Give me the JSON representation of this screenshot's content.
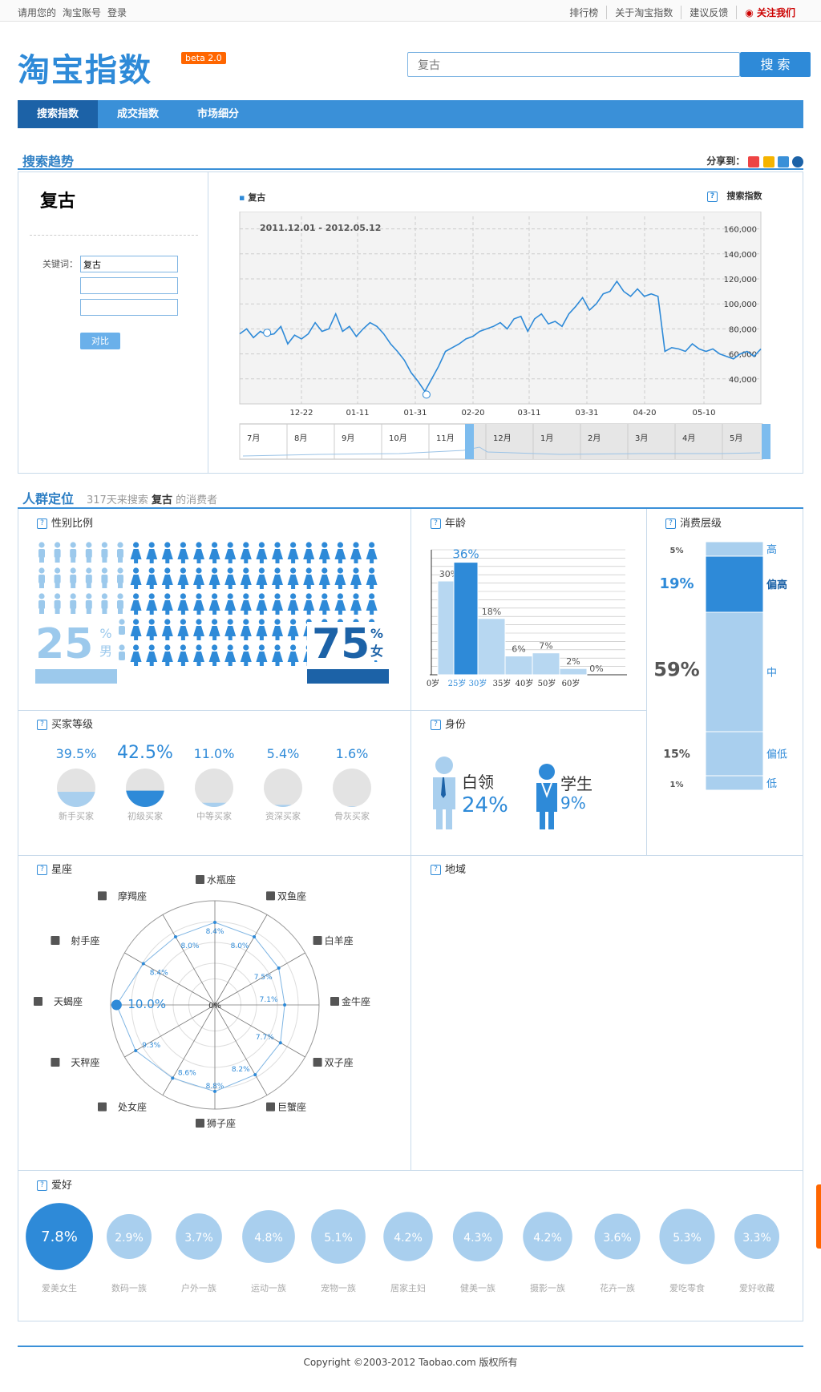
{
  "topbar": {
    "login_prompt": "请用您的",
    "account": "淘宝账号",
    "login": "登录",
    "links": [
      "排行榜",
      "关于淘宝指数",
      "建议反馈"
    ],
    "follow": "关注我们"
  },
  "header": {
    "logo": "淘宝指数",
    "beta": "beta 2.0",
    "search_value": "复古",
    "search_button": "搜 索"
  },
  "nav": {
    "tabs": [
      "搜索指数",
      "成交指数",
      "市场细分"
    ],
    "active": 0
  },
  "trend": {
    "section_title": "搜索趋势",
    "share_label": "分享到：",
    "keyword_title": "复古",
    "kw_label": "关键词：",
    "kw_values": [
      "复古",
      "",
      ""
    ],
    "compare_button": "对比",
    "legend": "复古",
    "index_label": "搜索指数",
    "date_range": "2011.12.01 - 2012.05.12",
    "help": "?"
  },
  "chart_data": {
    "type": "line",
    "title": "",
    "date_range": "2011.12.01 - 2012.05.12",
    "series": [
      {
        "name": "复古",
        "values": [
          76000,
          80000,
          73000,
          78000,
          75000,
          76000,
          82000,
          68000,
          75000,
          72000,
          76000,
          85000,
          78000,
          80000,
          92000,
          78000,
          82000,
          74000,
          80000,
          85000,
          82000,
          76000,
          68000,
          62000,
          55000,
          45000,
          38000,
          30000,
          40000,
          50000,
          62000,
          65000,
          68000,
          72000,
          74000,
          78000,
          80000,
          82000,
          85000,
          80000,
          88000,
          90000,
          78000,
          88000,
          92000,
          84000,
          86000,
          82000,
          92000,
          98000,
          105000,
          95000,
          100000,
          108000,
          110000,
          118000,
          110000,
          106000,
          112000,
          106000,
          108000,
          106000,
          62000,
          65000,
          64000,
          62000,
          68000,
          64000,
          62000,
          64000,
          60000,
          58000,
          56000,
          60000,
          62000,
          58000,
          64000
        ]
      }
    ],
    "x_tick_labels": [
      "12-22",
      "01-11",
      "01-31",
      "02-20",
      "03-11",
      "03-31",
      "04-20",
      "05-10"
    ],
    "y_tick_labels": [
      "40,000",
      "60,000",
      "80,000",
      "100,000",
      "120,000",
      "140,000",
      "160,000"
    ],
    "ylim": [
      20000,
      170000
    ],
    "grid": true,
    "nav_months": [
      "7月",
      "8月",
      "9月",
      "10月",
      "11月",
      "12月",
      "1月",
      "2月",
      "3月",
      "4月",
      "5月"
    ]
  },
  "crowd": {
    "section_title": "人群定位",
    "prefix": "317天来搜索",
    "keyword": "复古",
    "suffix": "的消费者"
  },
  "gender": {
    "title": "性别比例",
    "male_pct": "25",
    "male_label": "男",
    "female_pct": "75",
    "female_label": "女",
    "pct_sign": "%",
    "male_value": 0.25,
    "female_value": 0.75
  },
  "age": {
    "title": "年龄",
    "bars": [
      {
        "label": "0岁",
        "value": 0
      },
      {
        "label": "25岁",
        "value": 30
      },
      {
        "label": "30岁",
        "value": 36
      },
      {
        "label": "35岁",
        "value": 18
      },
      {
        "label": "40岁",
        "value": 6
      },
      {
        "label": "50岁",
        "value": 7
      },
      {
        "label": "60岁",
        "value": 2
      }
    ],
    "value_labels": [
      "30%",
      "36%",
      "18%",
      "6%",
      "7%",
      "2%",
      "0%"
    ],
    "x_labels": [
      "0岁",
      "25岁",
      "30岁",
      "35岁",
      "40岁",
      "50岁",
      "60岁"
    ]
  },
  "consume": {
    "title": "消费层级",
    "levels": [
      {
        "pct": "5%",
        "name": "高",
        "value": 5
      },
      {
        "pct": "19%",
        "name": "偏高",
        "value": 19
      },
      {
        "pct": "59%",
        "name": "中",
        "value": 59
      },
      {
        "pct": "15%",
        "name": "偏低",
        "value": 15
      },
      {
        "pct": "1%",
        "name": "低",
        "value": 1
      }
    ]
  },
  "buyer": {
    "title": "买家等级",
    "items": [
      {
        "pct": "39.5%",
        "name": "新手买家",
        "value": 39.5
      },
      {
        "pct": "42.5%",
        "name": "初级买家",
        "value": 42.5
      },
      {
        "pct": "11.0%",
        "name": "中等买家",
        "value": 11.0
      },
      {
        "pct": "5.4%",
        "name": "资深买家",
        "value": 5.4
      },
      {
        "pct": "1.6%",
        "name": "骨灰买家",
        "value": 1.6
      }
    ]
  },
  "identity": {
    "title": "身份",
    "items": [
      {
        "name": "白领",
        "pct": "24%"
      },
      {
        "name": "学生",
        "pct": "9%"
      }
    ]
  },
  "zodiac": {
    "title": "星座",
    "center": "0%",
    "items": [
      {
        "name": "水瓶座",
        "pct": "8.4%",
        "value": 8.4
      },
      {
        "name": "双鱼座",
        "pct": "8.0%",
        "value": 8.0
      },
      {
        "name": "白羊座",
        "pct": "7.5%",
        "value": 7.5
      },
      {
        "name": "金牛座",
        "pct": "7.1%",
        "value": 7.1
      },
      {
        "name": "双子座",
        "pct": "7.7%",
        "value": 7.7
      },
      {
        "name": "巨蟹座",
        "pct": "8.2%",
        "value": 8.2
      },
      {
        "name": "狮子座",
        "pct": "8.8%",
        "value": 8.8
      },
      {
        "name": "处女座",
        "pct": "8.6%",
        "value": 8.6
      },
      {
        "name": "天秤座",
        "pct": "9.3%",
        "value": 9.3
      },
      {
        "name": "天蝎座",
        "pct": "10.0%",
        "value": 10.0
      },
      {
        "name": "射手座",
        "pct": "8.4%",
        "value": 8.4
      },
      {
        "name": "摩羯座",
        "pct": "8.0%",
        "value": 8.0
      }
    ]
  },
  "region": {
    "title": "地域"
  },
  "hobby": {
    "title": "爱好",
    "items": [
      {
        "pct": "7.8%",
        "name": "爱美女生",
        "value": 7.8
      },
      {
        "pct": "2.9%",
        "name": "数码一族",
        "value": 2.9
      },
      {
        "pct": "3.7%",
        "name": "户外一族",
        "value": 3.7
      },
      {
        "pct": "4.8%",
        "name": "运动一族",
        "value": 4.8
      },
      {
        "pct": "5.1%",
        "name": "宠物一族",
        "value": 5.1
      },
      {
        "pct": "4.2%",
        "name": "居家主妇",
        "value": 4.2
      },
      {
        "pct": "4.3%",
        "name": "健美一族",
        "value": 4.3
      },
      {
        "pct": "4.2%",
        "name": "摄影一族",
        "value": 4.2
      },
      {
        "pct": "3.6%",
        "name": "花卉一族",
        "value": 3.6
      },
      {
        "pct": "5.3%",
        "name": "爱吃零食",
        "value": 5.3
      },
      {
        "pct": "3.3%",
        "name": "爱好收藏",
        "value": 3.3
      }
    ]
  },
  "footer": {
    "copyright": "Copyright ©2003-2012 Taobao.com 版权所有"
  },
  "colors": {
    "accent": "#3a90d8",
    "dark": "#1c62a7",
    "light": "#a9cfee"
  }
}
